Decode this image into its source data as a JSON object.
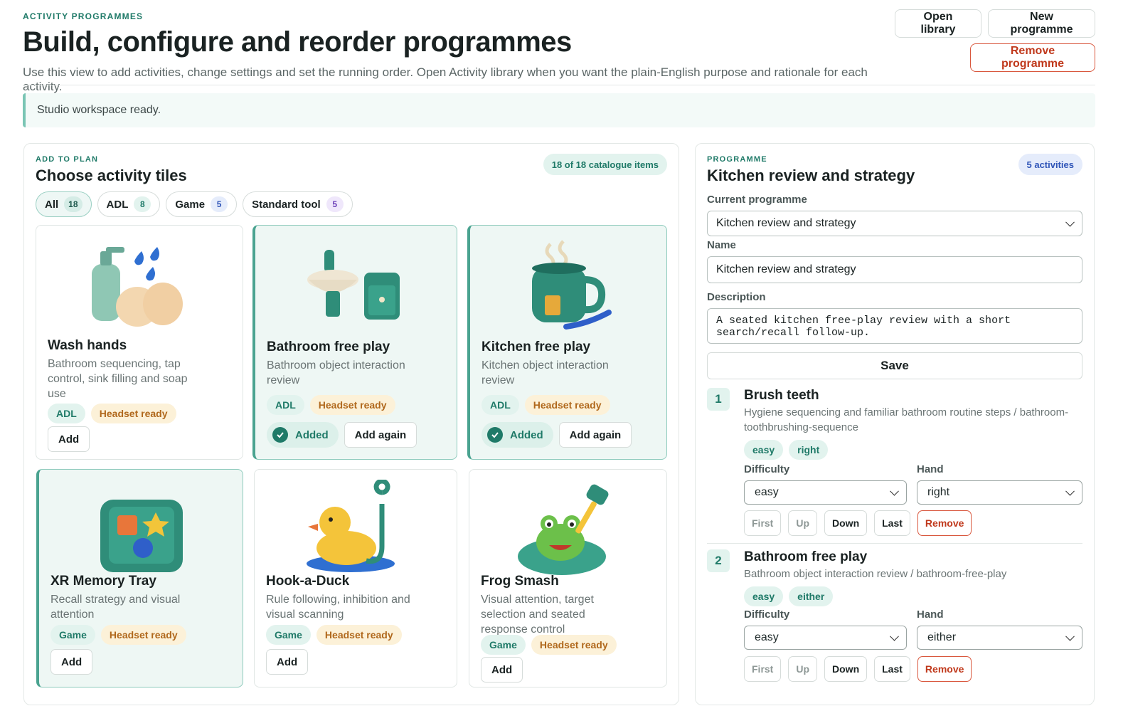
{
  "header": {
    "eyebrow": "ACTIVITY PROGRAMMES",
    "title": "Build, configure and reorder programmes",
    "subtitle": "Use this view to add activities, change settings and set the running order. Open Activity library when you want the plain-English purpose and rationale for each activity.",
    "open_library": "Open library",
    "new_programme": "New programme",
    "remove_programme": "Remove programme"
  },
  "status": "Studio workspace ready.",
  "left": {
    "eyebrow": "ADD TO PLAN",
    "title": "Choose activity tiles",
    "count": "18 of 18 catalogue items",
    "filters": [
      {
        "label": "All",
        "count": "18"
      },
      {
        "label": "ADL",
        "count": "8"
      },
      {
        "label": "Game",
        "count": "5"
      },
      {
        "label": "Standard tool",
        "count": "5"
      }
    ],
    "cards": [
      {
        "title": "Wash hands",
        "desc": "Bathroom sequencing, tap control, sink filling and soap use",
        "tag": "ADL",
        "headset": "Headset ready",
        "add": "Add"
      },
      {
        "title": "Bathroom free play",
        "desc": "Bathroom object interaction review",
        "tag": "ADL",
        "headset": "Headset ready",
        "added": "Added",
        "add_again": "Add again"
      },
      {
        "title": "Kitchen free play",
        "desc": "Kitchen object interaction review",
        "tag": "ADL",
        "headset": "Headset ready",
        "added": "Added",
        "add_again": "Add again"
      },
      {
        "title": "XR Memory Tray",
        "desc": "Recall strategy and visual attention",
        "tag": "Game",
        "headset": "Headset ready",
        "add": "Add"
      },
      {
        "title": "Hook-a-Duck",
        "desc": "Rule following, inhibition and visual scanning",
        "tag": "Game",
        "headset": "Headset ready",
        "add": "Add"
      },
      {
        "title": "Frog Smash",
        "desc": "Visual attention, target selection and seated response control",
        "tag": "Game",
        "headset": "Headset ready",
        "add": "Add"
      }
    ]
  },
  "right": {
    "eyebrow": "PROGRAMME",
    "title": "Kitchen review and strategy",
    "count": "5 activities",
    "current_label": "Current programme",
    "current_value": "Kitchen review and strategy",
    "name_label": "Name",
    "name_value": "Kitchen review and strategy",
    "desc_label": "Description",
    "desc_value": "A seated kitchen free-play review with a short\nsearch/recall follow-up.",
    "save": "Save",
    "difficulty_label": "Difficulty",
    "hand_label": "Hand",
    "order": {
      "first": "First",
      "up": "Up",
      "down": "Down",
      "last": "Last",
      "remove": "Remove"
    },
    "activities": [
      {
        "num": "1",
        "title": "Brush teeth",
        "desc": "Hygiene sequencing and familiar bathroom routine steps / bathroom-toothbrushing-sequence",
        "tag1": "easy",
        "tag2": "right",
        "difficulty": "easy",
        "hand": "right"
      },
      {
        "num": "2",
        "title": "Bathroom free play",
        "desc": "Bathroom object interaction review / bathroom-free-play",
        "tag1": "easy",
        "tag2": "either",
        "difficulty": "easy",
        "hand": "either"
      }
    ]
  },
  "colors": {
    "accent": "#1f7a68",
    "danger": "#c0391c",
    "mint": "#e2f3ee",
    "cream": "#fcf1d8"
  }
}
